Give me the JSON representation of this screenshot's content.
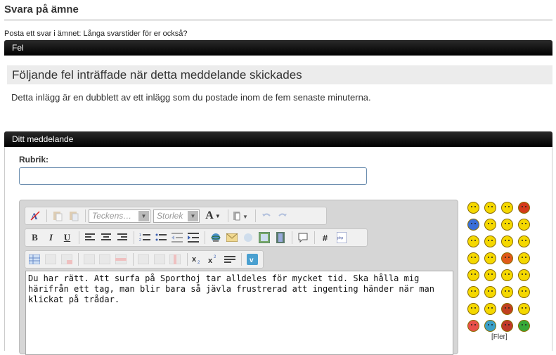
{
  "page": {
    "title": "Svara på ämne",
    "reply_link": "Posta ett svar i ämnet: Långa svarstider för er också?"
  },
  "error": {
    "bar_label": "Fel",
    "heading": "Följande fel inträffade när detta meddelande skickades",
    "message": "Detta inlägg är en dubblett av ett inlägg som du postade inom de fem senaste minuterna."
  },
  "message_panel": {
    "bar_label": "Ditt meddelande",
    "subject_label": "Rubrik:",
    "subject_value": "",
    "body_text": "Du har rätt. Att surfa på Sporthoj tar alldeles för mycket tid. Ska hålla mig härifrån ett tag, man blir bara så jävla frustrerad att ingenting händer när man klickat på trådar."
  },
  "toolbar": {
    "font_combo": "Teckens…",
    "size_combo": "Storlek",
    "bold": "B",
    "italic": "I",
    "underline": "U",
    "hash": "#",
    "font_color": "A"
  },
  "smilies": {
    "more_label": "[Fler]",
    "colors": [
      "#f5d800",
      "#f5d800",
      "#f5d800",
      "#d43a1a",
      "#3a6fd8",
      "#f5d800",
      "#f5d800",
      "#f5d800",
      "#f5d800",
      "#f5d800",
      "#f5d800",
      "#f5d800",
      "#f5d800",
      "#f5d800",
      "#e05a1a",
      "#f5d800",
      "#f5d800",
      "#f5d800",
      "#f5d800",
      "#f5d800",
      "#f5d800",
      "#f5d800",
      "#f5d800",
      "#f5d800",
      "#f5d800",
      "#f5d800",
      "#c04020",
      "#f5d800",
      "#e8504a",
      "#3aa0c8",
      "#c03a2a",
      "#38a838"
    ]
  }
}
